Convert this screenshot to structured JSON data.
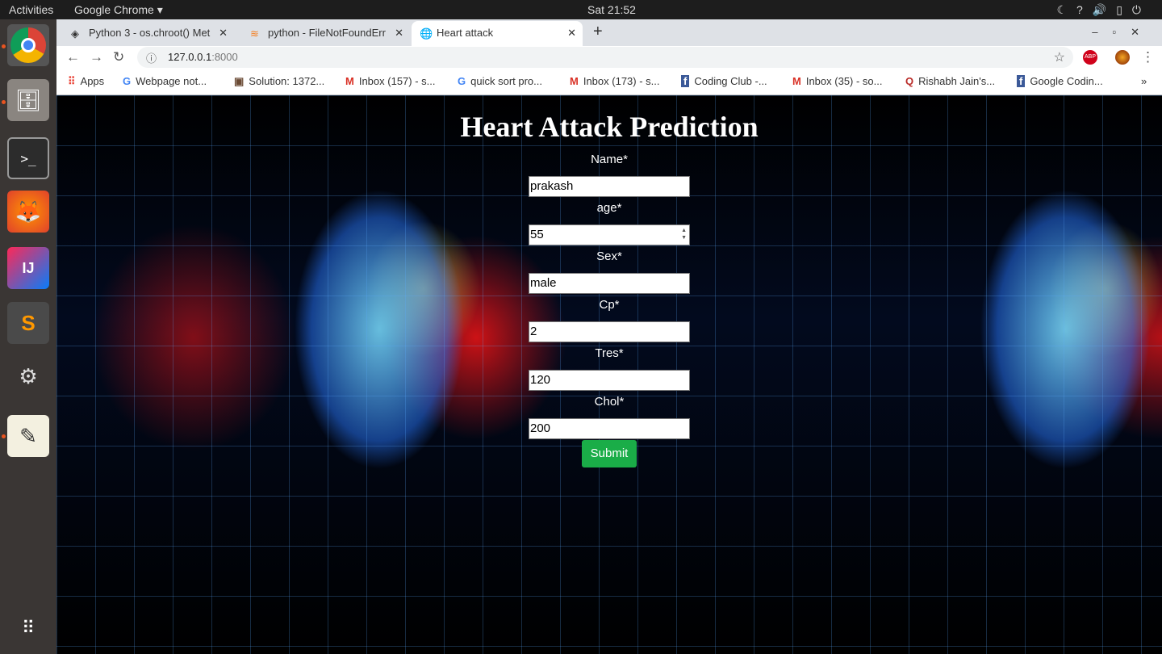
{
  "system": {
    "activities": "Activities",
    "app_menu": "Google Chrome ▾",
    "clock": "Sat 21:52",
    "tray_icons": [
      "night-icon",
      "help-icon",
      "volume-icon",
      "battery-icon",
      "power-icon"
    ]
  },
  "dock": [
    {
      "name": "chrome"
    },
    {
      "name": "files"
    },
    {
      "name": "terminal"
    },
    {
      "name": "firefox"
    },
    {
      "name": "intellij"
    },
    {
      "name": "sublime"
    },
    {
      "name": "settings"
    },
    {
      "name": "text-editor"
    },
    {
      "name": "show-apps"
    }
  ],
  "tabs": [
    {
      "label": "Python 3 - os.chroot() Met"
    },
    {
      "label": "python - FileNotFoundErr"
    },
    {
      "label": "Heart attack",
      "active": true
    }
  ],
  "address": {
    "host": "127.0.0.1",
    "port": ":8000"
  },
  "bookmarks": [
    {
      "label": "Apps"
    },
    {
      "label": "Webpage not..."
    },
    {
      "label": "Solution: 1372..."
    },
    {
      "label": "Inbox (157) - s..."
    },
    {
      "label": "quick sort pro..."
    },
    {
      "label": "Inbox (173) - s..."
    },
    {
      "label": "Coding Club -..."
    },
    {
      "label": "Inbox (35) - so..."
    },
    {
      "label": "Rishabh Jain's..."
    },
    {
      "label": "Google Codin..."
    }
  ],
  "page": {
    "title": "Heart Attack Prediction",
    "fields": [
      {
        "label": "Name*",
        "value": "prakash"
      },
      {
        "label": "age*",
        "value": "55"
      },
      {
        "label": "Sex*",
        "value": "male"
      },
      {
        "label": "Cp*",
        "value": "2"
      },
      {
        "label": "Tres*",
        "value": "120"
      },
      {
        "label": "Chol*",
        "value": "200"
      }
    ],
    "submit": "Submit",
    "submit_color": "#1aad48"
  }
}
